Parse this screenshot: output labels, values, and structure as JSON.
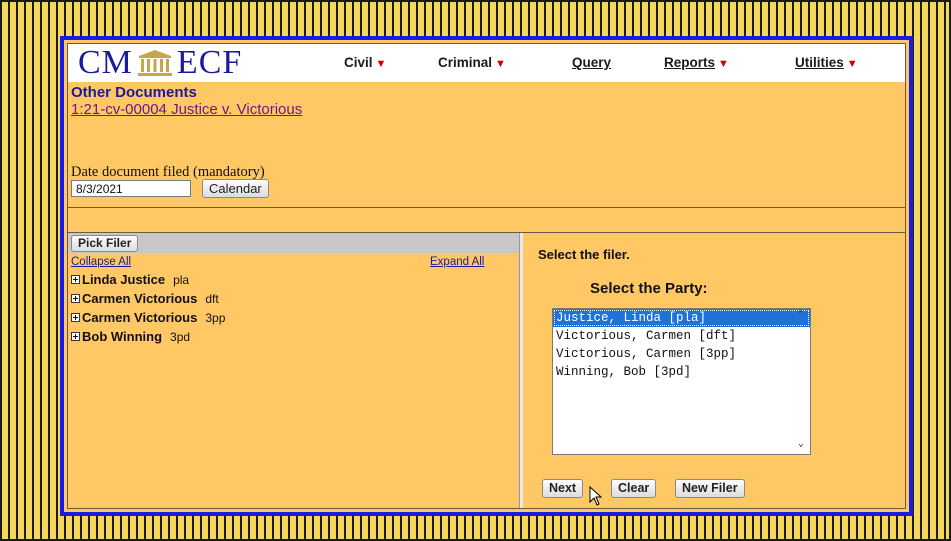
{
  "logo": {
    "left_text": "CM",
    "right_text": "ECF",
    "icon": "courthouse-icon"
  },
  "menu": [
    {
      "label": "Civil",
      "caret": true
    },
    {
      "label": "Criminal",
      "caret": true
    },
    {
      "label": "Query",
      "caret": false
    },
    {
      "label": "Reports",
      "caret": true
    },
    {
      "label": "Utilities",
      "caret": true
    }
  ],
  "page": {
    "title": "Other Documents",
    "case_link": "1:21-cv-00004 Justice v. Victorious"
  },
  "date": {
    "label": "Date document filed (mandatory)",
    "value": "8/3/2021",
    "calendar_label": "Calendar"
  },
  "left": {
    "pick_filer_label": "Pick Filer",
    "collapse_all": "Collapse All",
    "expand_all": "Expand All",
    "tree": [
      {
        "name": "Linda Justice",
        "role": "pla"
      },
      {
        "name": "Carmen Victorious",
        "role": "dft"
      },
      {
        "name": "Carmen Victorious",
        "role": "3pp"
      },
      {
        "name": "Bob Winning",
        "role": "3pd"
      }
    ]
  },
  "right": {
    "select_filer_text": "Select the filer.",
    "select_party_heading": "Select the Party:",
    "parties": [
      "Justice, Linda [pla]",
      "Victorious, Carmen [dft]",
      "Victorious, Carmen [3pp]",
      "Winning, Bob [3pd]"
    ],
    "selected_party": "Justice, Linda [pla]",
    "next_label": "Next",
    "clear_label": "Clear",
    "new_filer_label": "New Filer"
  },
  "colors": {
    "background_stripes": "#f5d75f",
    "frame_border": "#1a1ae0",
    "panel_bg": "#ffc865",
    "logo_blue": "#1a1a9c",
    "menu_caret": "#d00000",
    "selection_blue": "#1f72d8"
  }
}
